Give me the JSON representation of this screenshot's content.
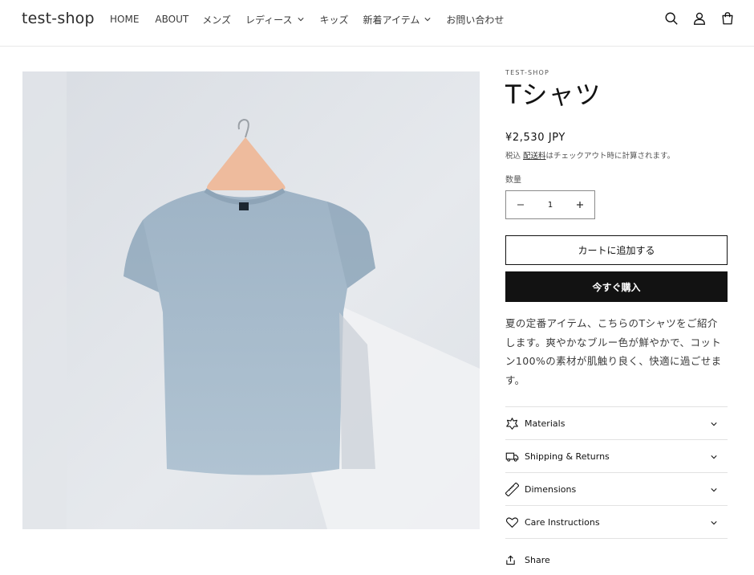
{
  "header": {
    "logo": "test-shop",
    "nav": [
      {
        "label": "HOME",
        "dropdown": false
      },
      {
        "label": "ABOUT",
        "dropdown": false
      },
      {
        "label": "メンズ",
        "dropdown": false
      },
      {
        "label": "レディース",
        "dropdown": true
      },
      {
        "label": "キッズ",
        "dropdown": false
      },
      {
        "label": "新着アイテム",
        "dropdown": true
      },
      {
        "label": "お問い合わせ",
        "dropdown": false
      }
    ],
    "icons": [
      "search-icon",
      "account-icon",
      "cart-icon"
    ]
  },
  "product": {
    "vendor": "TEST-SHOP",
    "title": "Tシャツ",
    "price": "¥2,530 JPY",
    "tax_prefix": "税込 ",
    "tax_link": "配送料",
    "tax_suffix": "はチェックアウト時に計算されます。",
    "quantity_label": "数量",
    "quantity_value": "1",
    "add_to_cart": "カートに追加する",
    "buy_now": "今すぐ購入",
    "description": "夏の定番アイテム、こちらのTシャツをご紹介します。爽やかなブルー色が鮮やかで、コットン100%の素材が肌触り良く、快適に過ごせます。",
    "accordions": [
      {
        "label": "Materials",
        "icon": "materials-icon"
      },
      {
        "label": "Shipping & Returns",
        "icon": "truck-icon"
      },
      {
        "label": "Dimensions",
        "icon": "ruler-icon"
      },
      {
        "label": "Care Instructions",
        "icon": "heart-icon"
      }
    ],
    "share_label": "Share"
  },
  "colors": {
    "text": "#121212",
    "button_dark": "#121212",
    "border": "#e2e2e2",
    "shirt": "#a9bccb"
  }
}
